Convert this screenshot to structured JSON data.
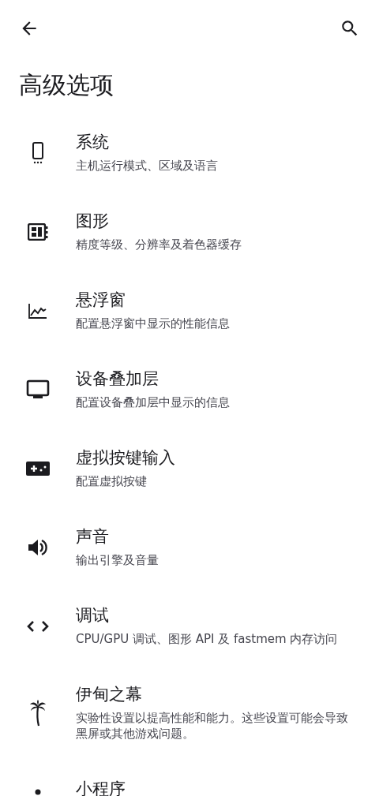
{
  "header": {
    "title": "高级选项"
  },
  "items": [
    {
      "title": "系统",
      "subtitle": "主机运行模式、区域及语言"
    },
    {
      "title": "图形",
      "subtitle": "精度等级、分辨率及着色器缓存"
    },
    {
      "title": "悬浮窗",
      "subtitle": "配置悬浮窗中显示的性能信息"
    },
    {
      "title": "设备叠加层",
      "subtitle": "配置设备叠加层中显示的信息"
    },
    {
      "title": "虚拟按键输入",
      "subtitle": "配置虚拟按键"
    },
    {
      "title": "声音",
      "subtitle": "输出引擎及音量"
    },
    {
      "title": "调试",
      "subtitle": "CPU/GPU 调试、图形 API 及 fastmem 内存访问"
    },
    {
      "title": "伊甸之幕",
      "subtitle": "实验性设置以提高性能和能力。这些设置可能会导致黑屏或其他游戏问题。"
    },
    {
      "title": "小程序"
    }
  ]
}
